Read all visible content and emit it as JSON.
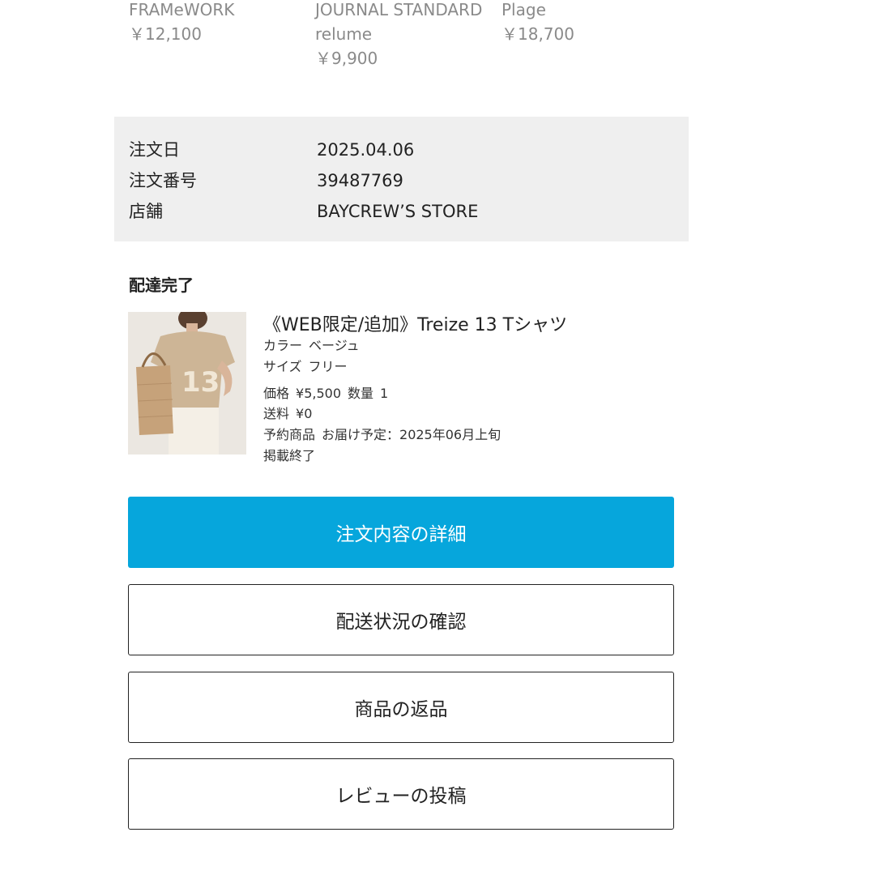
{
  "recommendations": [
    {
      "brand": "FRAMeWORK",
      "price": "￥12,100"
    },
    {
      "brand": "JOURNAL STANDARD",
      "brand_line2": "relume",
      "price": "￥9,900"
    },
    {
      "brand": "Plage",
      "price": "￥18,700"
    }
  ],
  "order": {
    "date_label": "注文日",
    "date_value": "2025.04.06",
    "number_label": "注文番号",
    "number_value": "39487769",
    "store_label": "店舗",
    "store_value": "BAYCREW’S STORE"
  },
  "delivery": {
    "status": "配達完了"
  },
  "product": {
    "title": "《WEB限定/追加》Treize 13 Tシャツ",
    "color_label": "カラー",
    "color_value": "ベージュ",
    "size_label": "サイズ",
    "size_value": "フリー",
    "price_label": "価格",
    "price_value": "¥5,500",
    "qty_label": "数量",
    "qty_value": "1",
    "shipping_label": "送料",
    "shipping_value": "¥0",
    "preorder_label": "予約商品",
    "delivery_schedule": "お届け予定：2025年06月上旬",
    "listing_status": "掲載終了"
  },
  "buttons": {
    "order_detail": "注文内容の詳細",
    "shipping_status": "配送状況の確認",
    "return": "商品の返品",
    "review": "レビューの投稿"
  },
  "colors": {
    "primary": "#06a6dc",
    "info_bg": "#efefef",
    "muted_text": "#8a8a8a"
  }
}
